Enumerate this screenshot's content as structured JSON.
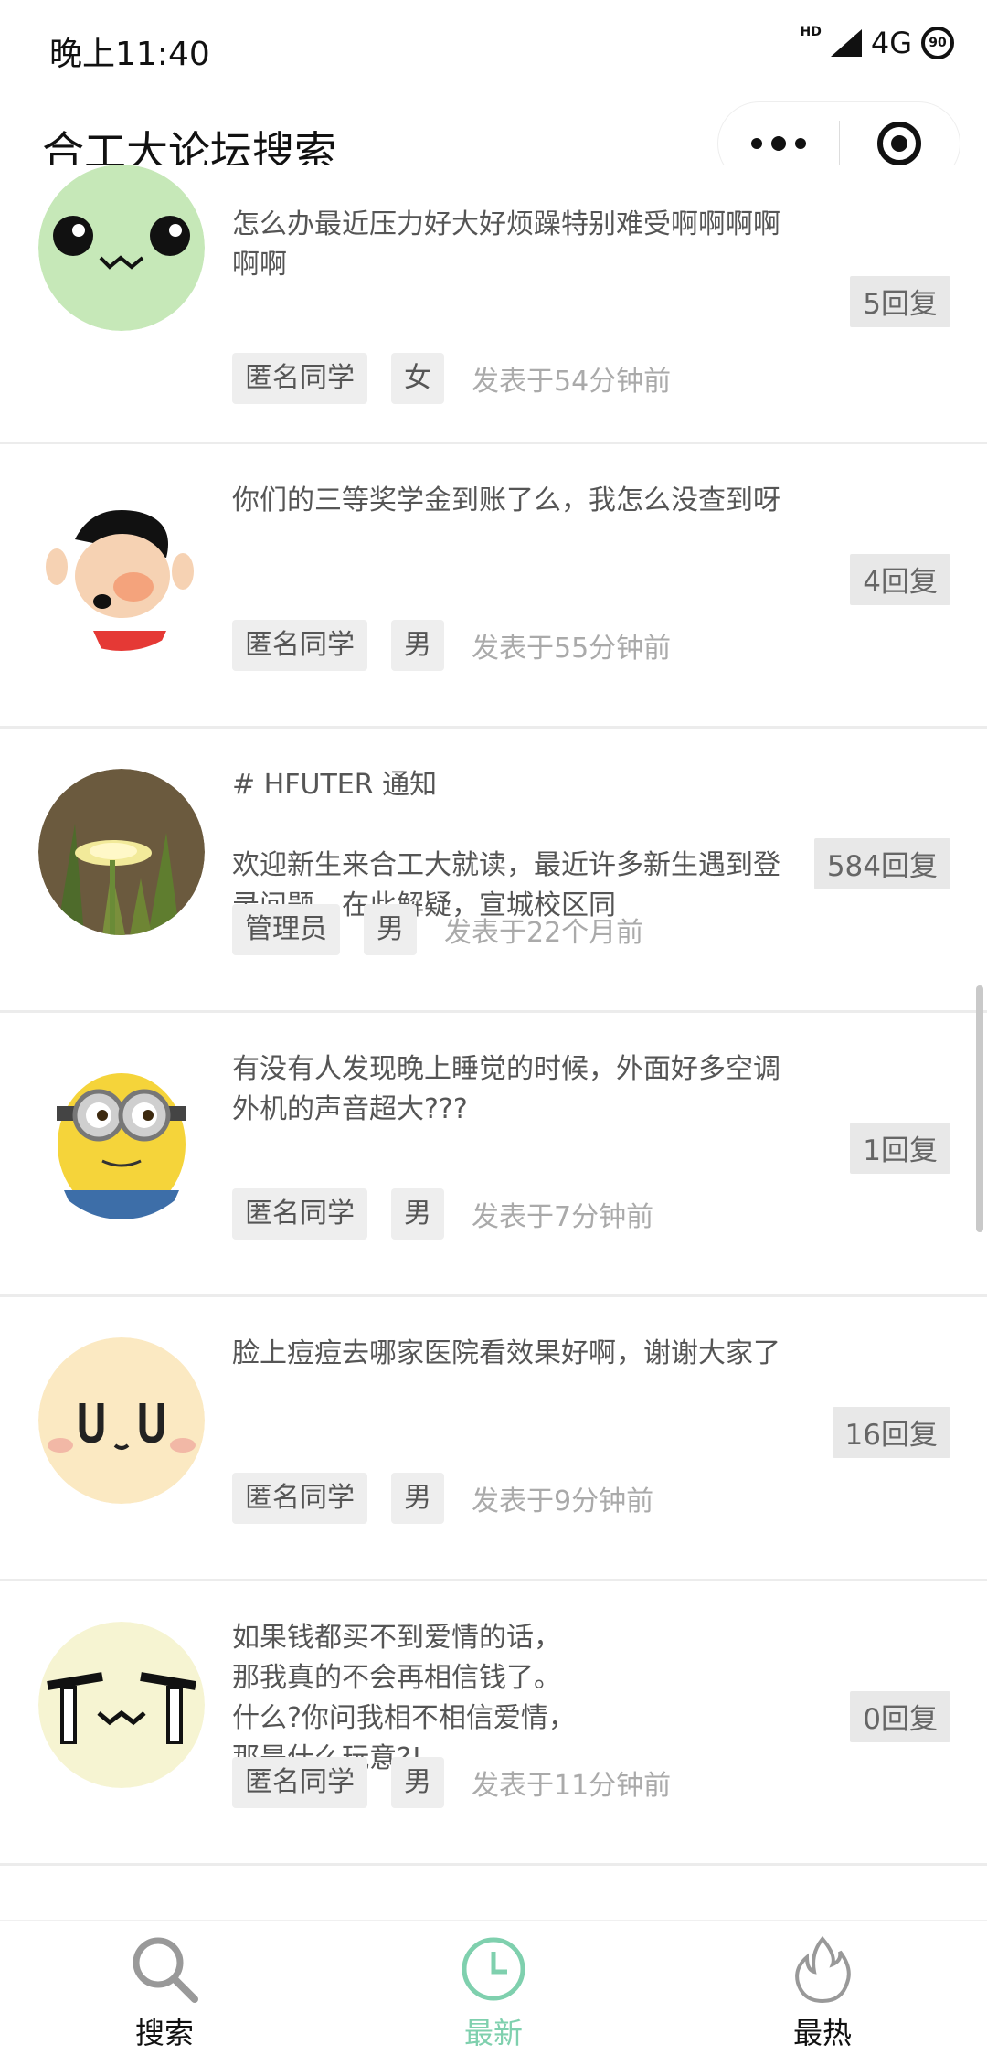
{
  "status_bar": {
    "time": "晚上11:40",
    "hd": "HD",
    "network": "4G",
    "battery": "90"
  },
  "nav": {
    "title": "合工大论坛搜索"
  },
  "posts": [
    {
      "text": "怎么办最近压力好大好烦躁特别难受啊啊啊啊啊啊",
      "replies": "5回复",
      "tags": [
        "匿名同学",
        "女"
      ],
      "time": "发表于54分钟前"
    },
    {
      "text": "你们的三等奖学金到账了么，我怎么没查到呀",
      "replies": "4回复",
      "tags": [
        "匿名同学",
        "男"
      ],
      "time": "发表于55分钟前"
    },
    {
      "text": "# HFUTER 通知\n\n欢迎新生来合工大就读，最近许多新生遇到登录问题，在此解疑，宣城校区同",
      "replies": "584回复",
      "tags": [
        "管理员",
        "男"
      ],
      "time": "发表于22个月前"
    },
    {
      "text": "有没有人发现晚上睡觉的时候，外面好多空调外机的声音超大???",
      "replies": "1回复",
      "tags": [
        "匿名同学",
        "男"
      ],
      "time": "发表于7分钟前"
    },
    {
      "text": "脸上痘痘去哪家医院看效果好啊，谢谢大家了",
      "replies": "16回复",
      "tags": [
        "匿名同学",
        "男"
      ],
      "time": "发表于9分钟前"
    },
    {
      "text": "如果钱都买不到爱情的话，\n那我真的不会再相信钱了。\n什么?你问我相不相信爱情，\n那是什么玩意?!",
      "replies": "0回复",
      "tags": [
        "匿名同学",
        "男"
      ],
      "time": "发表于11分钟前"
    }
  ],
  "tabs": [
    {
      "label": "搜索",
      "icon": "search-icon"
    },
    {
      "label": "最新",
      "icon": "clock-icon"
    },
    {
      "label": "最热",
      "icon": "flame-icon"
    }
  ],
  "colors": {
    "accent": "#7fd0ae",
    "tag_bg": "#eeeeee",
    "reply_bg": "#e8e8e8"
  }
}
